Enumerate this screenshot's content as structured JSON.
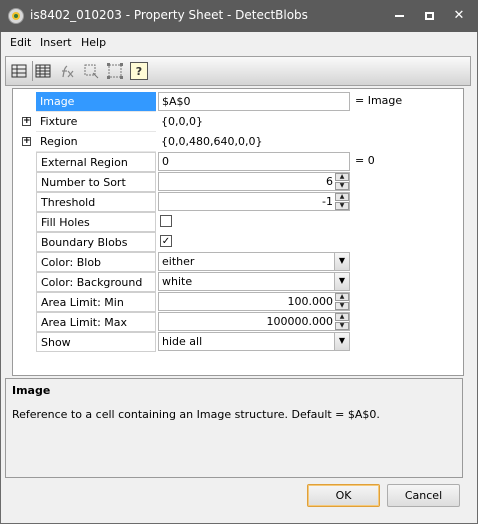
{
  "window": {
    "title": "is8402_010203 - Property Sheet - DetectBlobs"
  },
  "menu": [
    "Edit",
    "Insert",
    "Help"
  ],
  "toolbar": {
    "icons": [
      "table-insert-icon",
      "grid-icon",
      "fx-icon",
      "region-icon",
      "region-box-icon",
      "help-icon"
    ],
    "help_glyph": "?"
  },
  "properties": [
    {
      "label": "Image",
      "value": "$A$0",
      "note": "= Image",
      "kind": "input"
    },
    {
      "label": "Fixture",
      "value": "{0,0,0}",
      "kind": "text",
      "expandable": true
    },
    {
      "label": "Region",
      "value": "{0,0,480,640,0,0}",
      "kind": "text",
      "expandable": true
    },
    {
      "label": "External Region",
      "value": "0",
      "note": "= 0",
      "kind": "input"
    },
    {
      "label": "Number to Sort",
      "value": "6",
      "kind": "spin"
    },
    {
      "label": "Threshold",
      "value": "-1",
      "kind": "spin"
    },
    {
      "label": "Fill Holes",
      "checked": false,
      "kind": "check"
    },
    {
      "label": "Boundary Blobs",
      "checked": true,
      "kind": "check"
    },
    {
      "label": "Color: Blob",
      "value": "either",
      "kind": "select"
    },
    {
      "label": "Color: Background",
      "value": "white",
      "kind": "select"
    },
    {
      "label": "Area Limit: Min",
      "value": "100.000",
      "kind": "spin"
    },
    {
      "label": "Area Limit: Max",
      "value": "100000.000",
      "kind": "spin"
    },
    {
      "label": "Show",
      "value": "hide all",
      "kind": "select"
    }
  ],
  "description": {
    "title": "Image",
    "text": "Reference to a cell containing an Image structure. Default = $A$0."
  },
  "buttons": {
    "ok": "OK",
    "cancel": "Cancel"
  },
  "glyphs": {
    "expand": "+",
    "check": "✓",
    "arrow_down": "▼",
    "arrow_up": "▲",
    "close": "✕"
  }
}
